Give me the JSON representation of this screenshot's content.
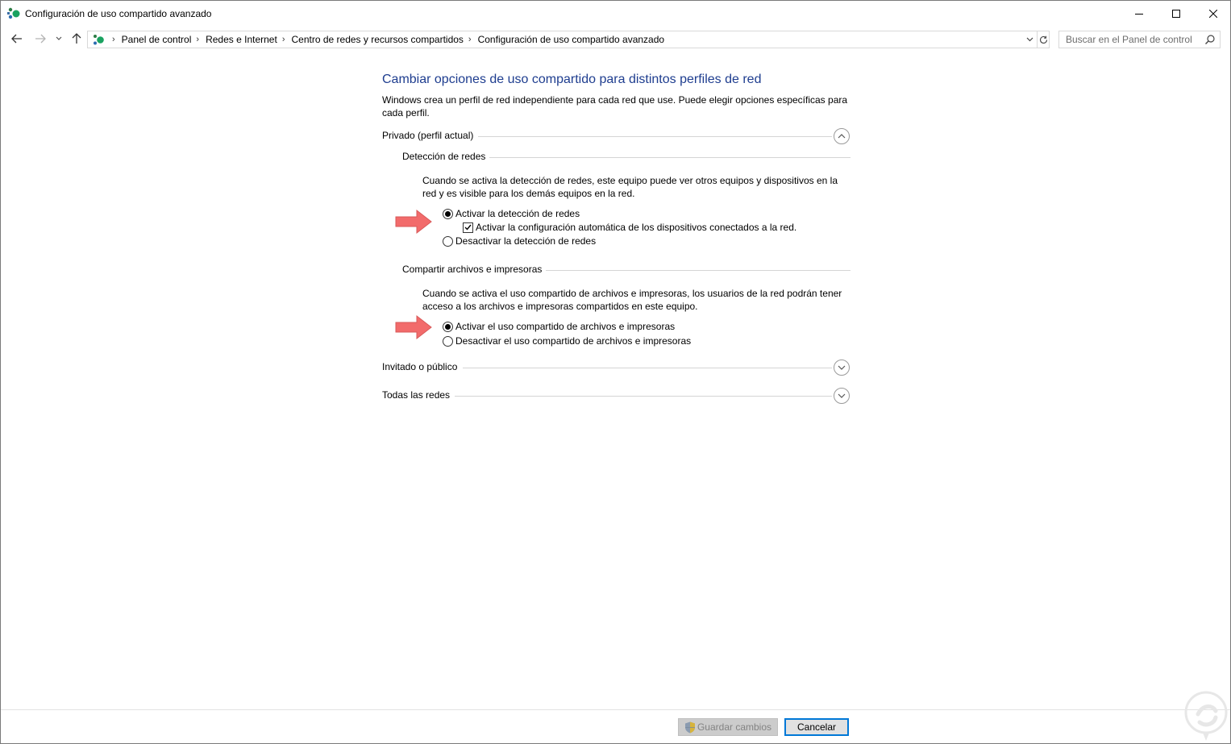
{
  "window": {
    "title": "Configuración de uso compartido avanzado",
    "controls": [
      "minimize",
      "maximize",
      "close"
    ]
  },
  "nav": {
    "breadcrumbs": [
      "Panel de control",
      "Redes e Internet",
      "Centro de redes y recursos compartidos",
      "Configuración de uso compartido avanzado"
    ],
    "search_placeholder": "Buscar en el Panel de control"
  },
  "main": {
    "title": "Cambiar opciones de uso compartido para distintos perfiles de red",
    "intro": "Windows crea un perfil de red independiente para cada red que use. Puede elegir opciones específicas para cada perfil.",
    "profiles": [
      {
        "label": "Privado (perfil actual)",
        "expanded": true,
        "subsections": [
          {
            "label": "Detección de redes",
            "description": "Cuando se activa la detección de redes, este equipo puede ver otros equipos y dispositivos en la red y es visible para los demás equipos en la red.",
            "options": [
              {
                "label": "Activar la detección de redes",
                "selected": true
              },
              {
                "label": "Activar la configuración automática de los dispositivos conectados a la red.",
                "checked": true
              },
              {
                "label": "Desactivar la detección de redes",
                "selected": false
              }
            ]
          },
          {
            "label": "Compartir archivos e impresoras",
            "description": "Cuando se activa el uso compartido de archivos e impresoras, los usuarios de la red podrán tener acceso a los archivos e impresoras compartidos en este equipo.",
            "options": [
              {
                "label": "Activar el uso compartido de archivos e impresoras",
                "selected": true
              },
              {
                "label": "Desactivar el uso compartido de archivos e impresoras",
                "selected": false
              }
            ]
          }
        ]
      },
      {
        "label": "Invitado o público",
        "expanded": false
      },
      {
        "label": "Todas las redes",
        "expanded": false
      }
    ]
  },
  "footer": {
    "save_label": "Guardar cambios",
    "cancel_label": "Cancelar"
  },
  "colors": {
    "title_blue": "#1e3d8f",
    "annotation_arrow": "#f26b6b",
    "focus_blue": "#0078d7"
  }
}
